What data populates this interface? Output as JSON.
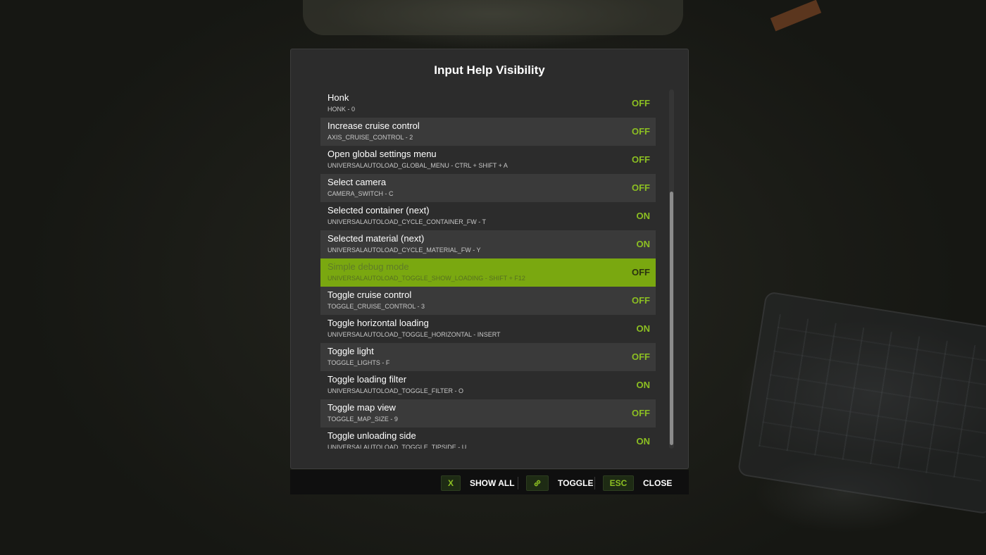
{
  "dialog": {
    "title": "Input Help Visibility"
  },
  "items": [
    {
      "label": "Honk",
      "binding": "HONK - 0",
      "state": "OFF"
    },
    {
      "label": "Increase cruise control",
      "binding": "AXIS_CRUISE_CONTROL - 2",
      "state": "OFF"
    },
    {
      "label": "Open global settings menu",
      "binding": "UNIVERSALAUTOLOAD_GLOBAL_MENU - Ctrl + Shift + A",
      "state": "OFF"
    },
    {
      "label": "Select camera",
      "binding": "CAMERA_SWITCH - C",
      "state": "OFF"
    },
    {
      "label": "Selected container (next)",
      "binding": "UNIVERSALAUTOLOAD_CYCLE_CONTAINER_FW - T",
      "state": "ON"
    },
    {
      "label": "Selected material (next)",
      "binding": "UNIVERSALAUTOLOAD_CYCLE_MATERIAL_FW - Y",
      "state": "ON"
    },
    {
      "label": "Simple debug mode",
      "binding": "UNIVERSALAUTOLOAD_TOGGLE_SHOW_LOADING - Shift + F12",
      "state": "OFF",
      "selected": true
    },
    {
      "label": "Toggle cruise control",
      "binding": "TOGGLE_CRUISE_CONTROL - 3",
      "state": "OFF"
    },
    {
      "label": "Toggle horizontal loading",
      "binding": "UNIVERSALAUTOLOAD_TOGGLE_HORIZONTAL - Insert",
      "state": "ON"
    },
    {
      "label": "Toggle light",
      "binding": "TOGGLE_LIGHTS - F",
      "state": "OFF"
    },
    {
      "label": "Toggle loading filter",
      "binding": "UNIVERSALAUTOLOAD_TOGGLE_FILTER - O",
      "state": "ON"
    },
    {
      "label": "Toggle map view",
      "binding": "TOGGLE_MAP_SIZE - 9",
      "state": "OFF"
    },
    {
      "label": "Toggle unloading side",
      "binding": "UNIVERSALAUTOLOAD_TOGGLE_TIPSIDE - U",
      "state": "ON"
    }
  ],
  "footer": {
    "show_all": {
      "key": "X",
      "label": "SHOW ALL"
    },
    "toggle": {
      "key_icon": "link-icon",
      "label": "TOGGLE"
    },
    "close": {
      "key": "ESC",
      "label": "CLOSE"
    }
  },
  "colors": {
    "accent": "#7aa810",
    "state_text": "#8cbf22",
    "row_alt": "#3a3a3a",
    "panel": "#2c2c2c"
  }
}
